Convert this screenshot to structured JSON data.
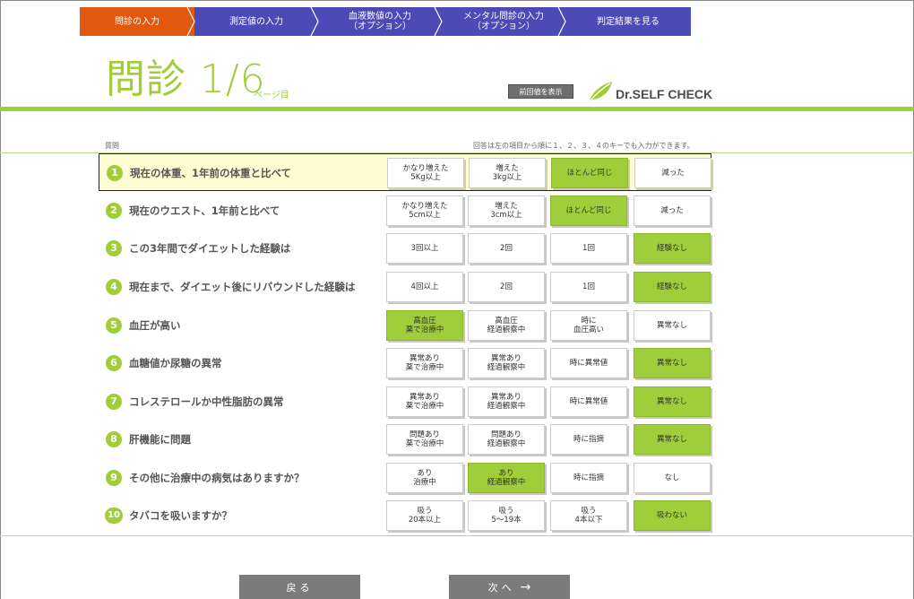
{
  "steps": [
    {
      "label": "問診の入力",
      "active": true
    },
    {
      "label": "測定値の入力",
      "active": false
    },
    {
      "label": "血液数値の入力\n（オプション）",
      "active": false
    },
    {
      "label": "メンタル問診の入力\n（オプション）",
      "active": false
    },
    {
      "label": "判定結果を見る",
      "active": false
    }
  ],
  "title": {
    "main": "問診 1/6",
    "suffix": "ページ目"
  },
  "prev_button": "前回値を表示",
  "logo": {
    "text": "Dr.SELF CHECK",
    "icon": "leaf-icon"
  },
  "table": {
    "column_label": "質問",
    "hint": "回答は左の項目から順に１、２、３、４のキーでも入力ができます。"
  },
  "questions": [
    {
      "num": "1",
      "text": "現在の体重、1年前の体重と比べて",
      "options": [
        "かなり増えた\n5Kg以上",
        "増えた\n3kg以上",
        "ほとんど同じ",
        "減った"
      ],
      "selected": 3,
      "current": true
    },
    {
      "num": "2",
      "text": "現在のウエスト、1年前と比べて",
      "options": [
        "かなり増えた\n5cm以上",
        "増えた\n3cm以上",
        "ほとんど同じ",
        "減った"
      ],
      "selected": 3,
      "current": false
    },
    {
      "num": "3",
      "text": "この3年間でダイエットした経験は",
      "options": [
        "3回以上",
        "2回",
        "1回",
        "経験なし"
      ],
      "selected": 4,
      "current": false
    },
    {
      "num": "4",
      "text": "現在まで、ダイエット後にリバウンドした経験は",
      "options": [
        "4回以上",
        "2回",
        "1回",
        "経験なし"
      ],
      "selected": 4,
      "current": false
    },
    {
      "num": "5",
      "text": "血圧が高い",
      "options": [
        "高血圧\n薬で治療中",
        "高血圧\n経過観察中",
        "時に\n血圧高い",
        "異常なし"
      ],
      "selected": 1,
      "current": false
    },
    {
      "num": "6",
      "text": "血糖値か尿糖の異常",
      "options": [
        "異常あり\n薬で治療中",
        "異常あり\n経過観察中",
        "時に異常値",
        "異常なし"
      ],
      "selected": 4,
      "current": false
    },
    {
      "num": "7",
      "text": "コレステロールか中性脂肪の異常",
      "options": [
        "異常あり\n薬で治療中",
        "異常あり\n経過観察中",
        "時に異常値",
        "異常なし"
      ],
      "selected": 4,
      "current": false
    },
    {
      "num": "8",
      "text": "肝機能に問題",
      "options": [
        "問題あり\n薬で治療中",
        "問題あり\n経過観察中",
        "時に指摘",
        "異常なし"
      ],
      "selected": 4,
      "current": false
    },
    {
      "num": "9",
      "text": "その他に治療中の病気はありますか？",
      "options": [
        "あり\n治療中",
        "あり\n経過観察中",
        "時に指摘",
        "なし"
      ],
      "selected": 2,
      "current": false
    },
    {
      "num": "10",
      "text": "タバコを吸いますか？",
      "options": [
        "吸う\n20本以上",
        "吸う\n5～19本",
        "吸う\n4本以下",
        "吸わない"
      ],
      "selected": 4,
      "current": false
    }
  ],
  "buttons": {
    "back": "戻る",
    "next": "次へ",
    "next_arrow": "→"
  },
  "colors": {
    "accent_green": "#9fce3a",
    "step_active": "#e2580e",
    "step_inactive": "#4c4ab6"
  }
}
